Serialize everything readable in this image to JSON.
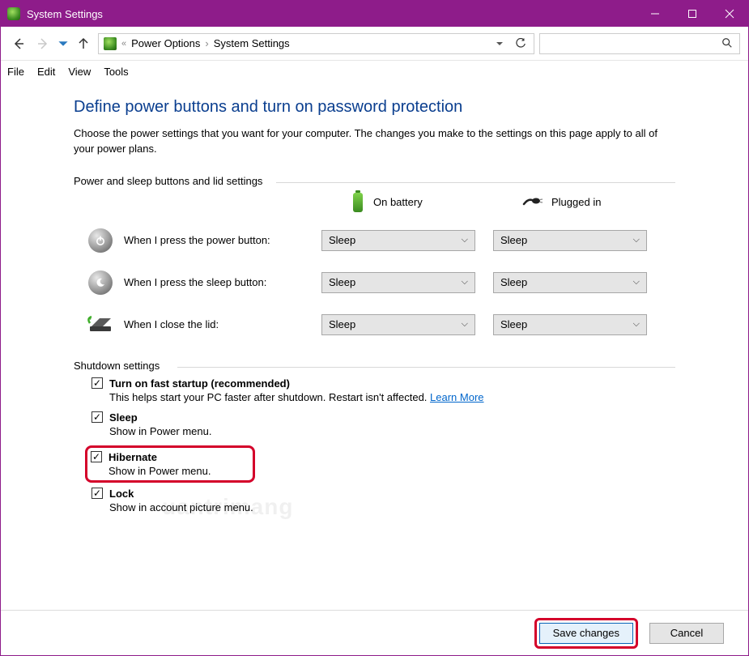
{
  "window": {
    "title": "System Settings"
  },
  "breadcrumb": {
    "parent": "Power Options",
    "current": "System Settings"
  },
  "menu": {
    "file": "File",
    "edit": "Edit",
    "view": "View",
    "tools": "Tools"
  },
  "page": {
    "heading": "Define power buttons and turn on password protection",
    "description": "Choose the power settings that you want for your computer. The changes you make to the settings on this page apply to all of your power plans."
  },
  "button_group": {
    "label": "Power and sleep buttons and lid settings",
    "col_battery": "On battery",
    "col_plugged": "Plugged in",
    "rows": [
      {
        "label": "When I press the power button:",
        "battery": "Sleep",
        "plugged": "Sleep"
      },
      {
        "label": "When I press the sleep button:",
        "battery": "Sleep",
        "plugged": "Sleep"
      },
      {
        "label": "When I close the lid:",
        "battery": "Sleep",
        "plugged": "Sleep"
      }
    ]
  },
  "shutdown": {
    "label": "Shutdown settings",
    "fast_startup": {
      "title": "Turn on fast startup (recommended)",
      "sub": "This helps start your PC faster after shutdown. Restart isn't affected. ",
      "link": "Learn More"
    },
    "sleep": {
      "title": "Sleep",
      "sub": "Show in Power menu."
    },
    "hibernate": {
      "title": "Hibernate",
      "sub": "Show in Power menu."
    },
    "lock": {
      "title": "Lock",
      "sub": "Show in account picture menu."
    }
  },
  "footer": {
    "save": "Save changes",
    "cancel": "Cancel"
  },
  "watermark": "uantrimang"
}
